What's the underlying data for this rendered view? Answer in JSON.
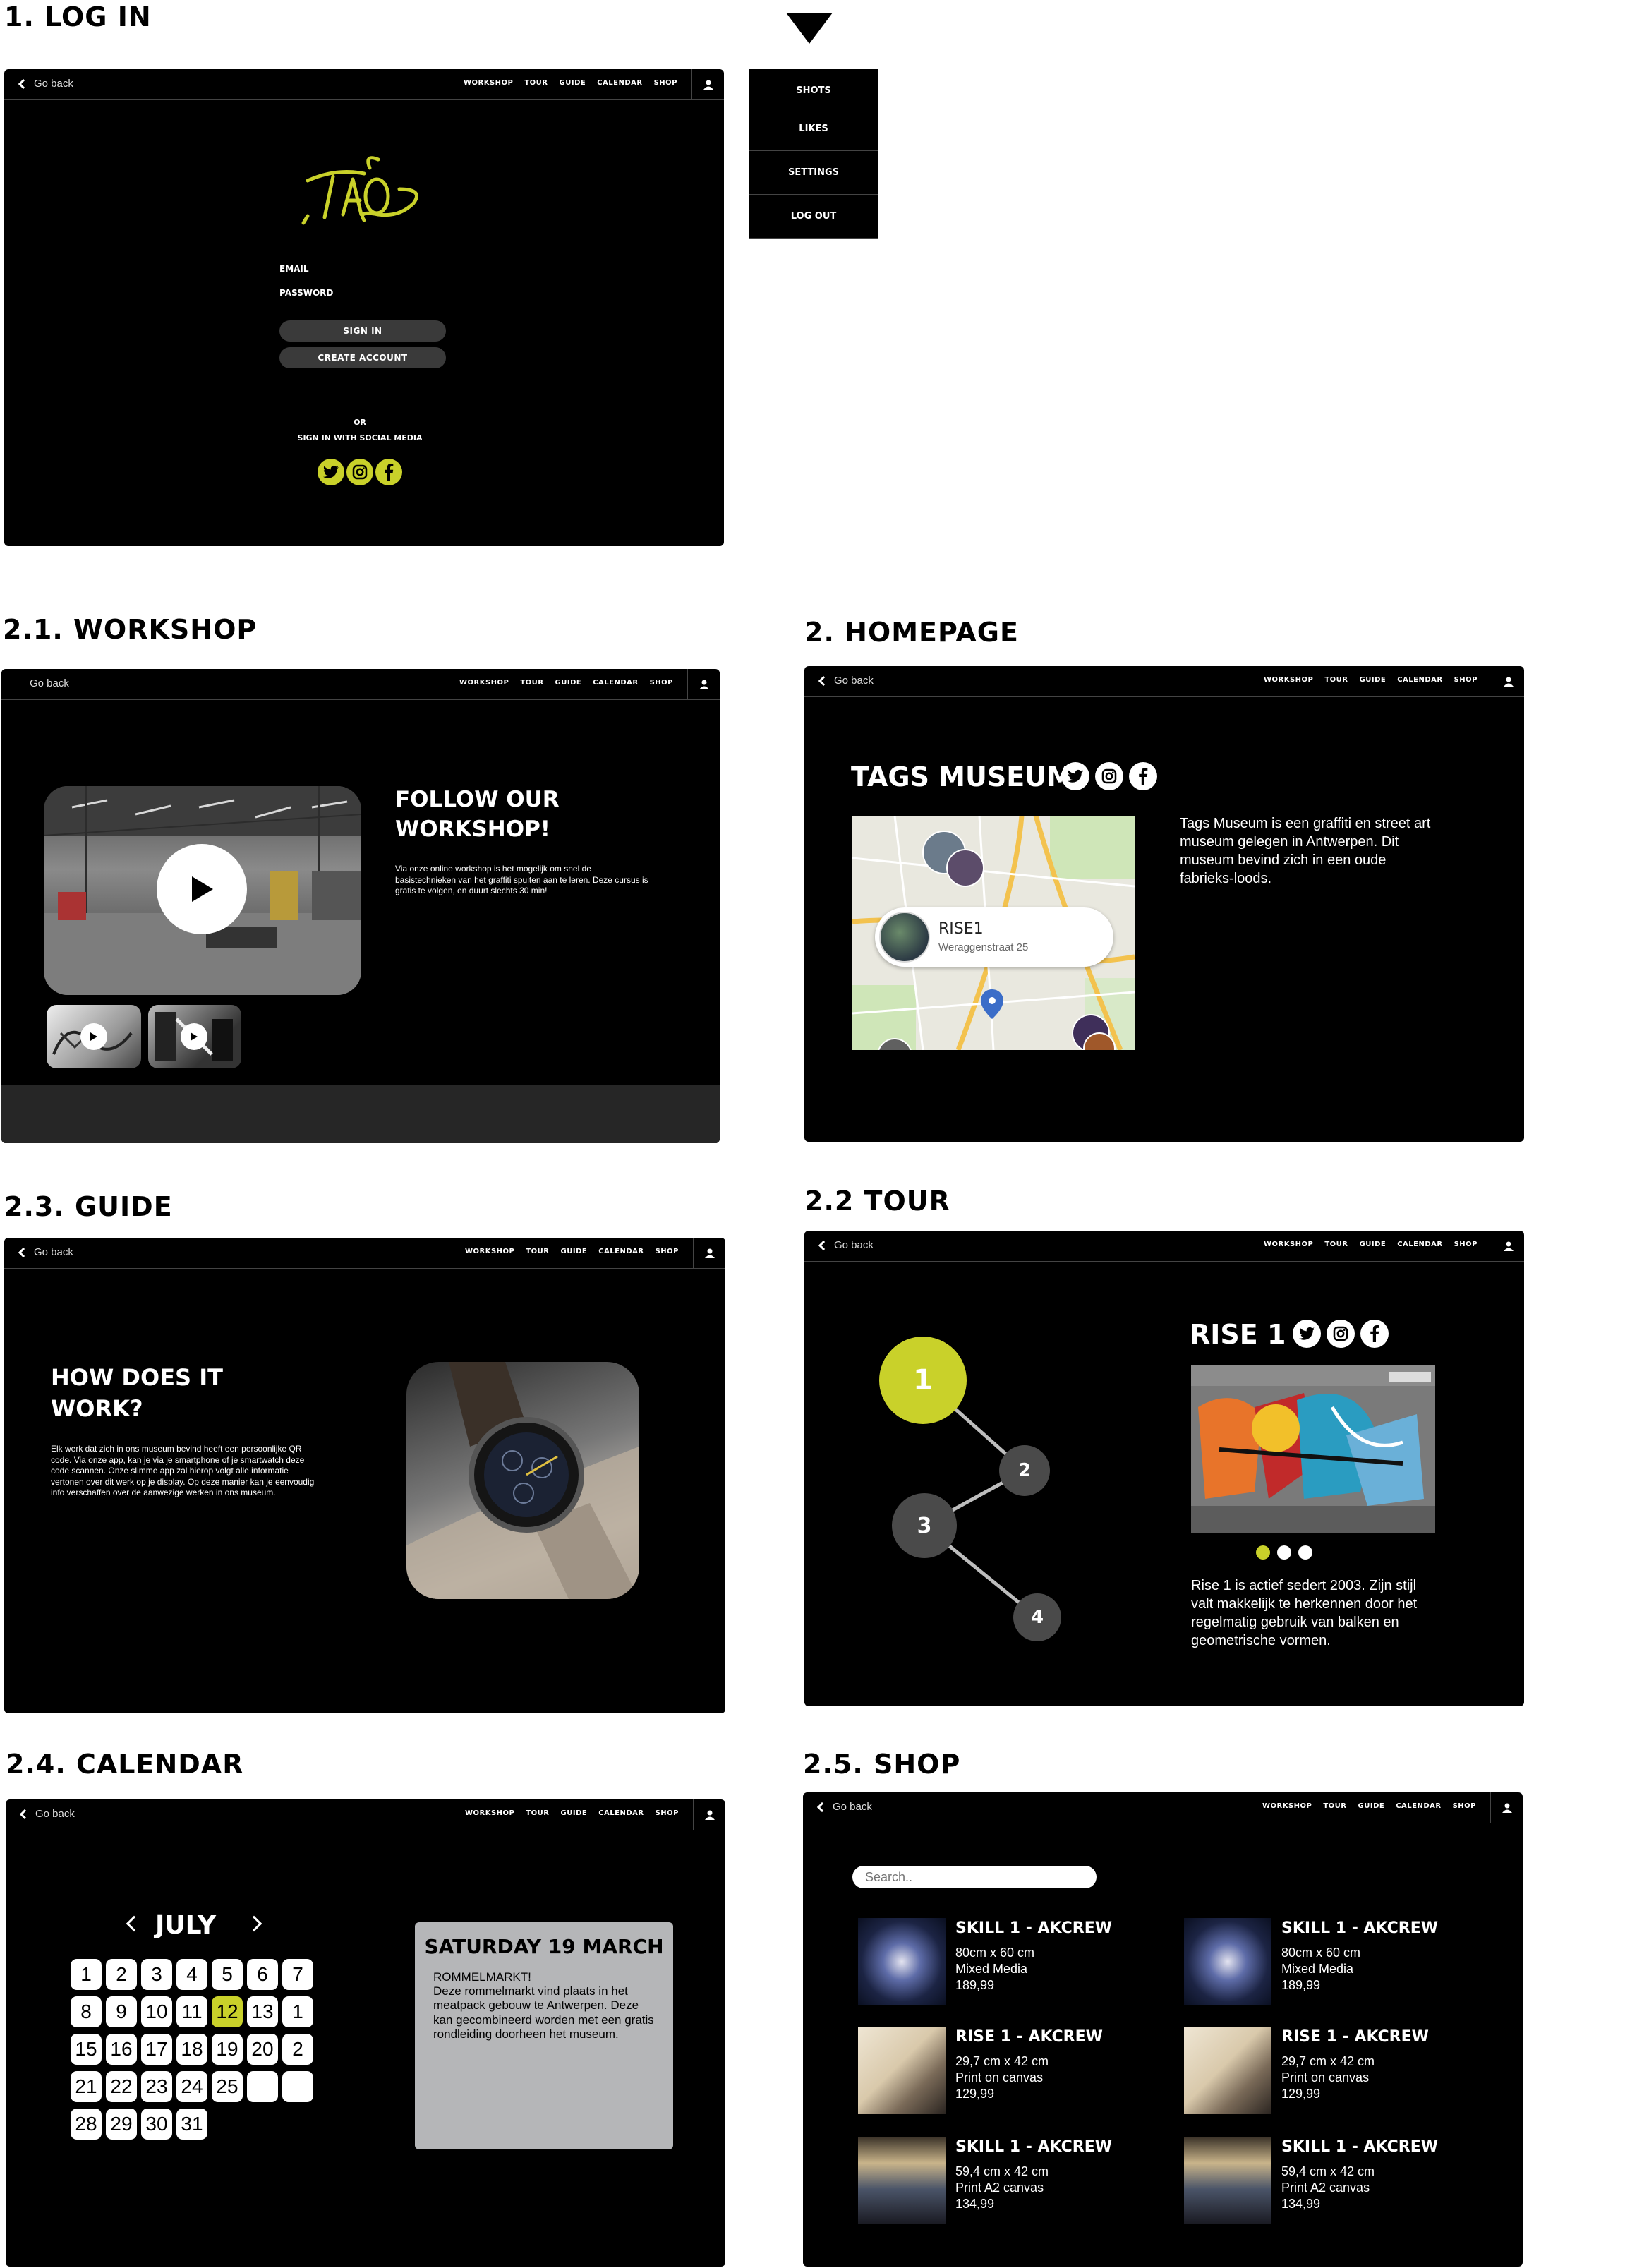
{
  "nav": {
    "back_label": "Go back",
    "links": [
      "WORKSHOP",
      "TOUR",
      "GUIDE",
      "CALENDAR",
      "SHOP"
    ]
  },
  "sections": {
    "login": "1. LOG IN",
    "workshop": "2.1. WORKSHOP",
    "homepage": "2. HOMEPAGE",
    "guide": "2.3. GUIDE",
    "tour": "2.2 TOUR",
    "calendar": "2.4. CALENDAR",
    "shop": "2.5. SHOP"
  },
  "user_menu": [
    "SHOTS",
    "LIKES",
    "SETTINGS",
    "LOG OUT"
  ],
  "login": {
    "email_label": "EMAIL",
    "password_label": "PASSWORD",
    "sign_in": "SIGN IN",
    "create_account": "CREATE ACCOUNT",
    "or": "OR",
    "social_text": "SIGN IN WITH SOCIAL MEDIA"
  },
  "workshop": {
    "title_line1": "FOLLOW OUR",
    "title_line2": "WORKSHOP!",
    "description": "Via onze online workshop is het mogelijk om snel de basistechnieken van het graffiti spuiten aan te leren. Deze cursus is gratis te volgen, en duurt slechts 30 min!"
  },
  "homepage": {
    "title": "TAGS MUSEUM",
    "description": "Tags Museum is een graffiti en street art museum gelegen in Antwerpen. Dit museum bevind zich in een oude fabrieks-loods.",
    "map_card_name": "RISE1",
    "map_card_address": "Weraggenstraat 25"
  },
  "guide": {
    "title_line1": "HOW DOES IT",
    "title_line2": "WORK?",
    "description": "Elk werk dat zich in ons museum bevind heeft een persoonlijke QR code. Via onze app, kan je via je smartphone of je smartwatch deze code scannen. Onze slimme app zal hierop volgt alle informatie vertonen over dit werk op je display. Op deze manier kan je eenvoudig info verschaffen over de aanwezige werken in ons museum."
  },
  "tour": {
    "nodes": [
      "1",
      "2",
      "3",
      "4"
    ],
    "artist": "RISE 1",
    "description": "Rise 1 is actief sedert 2003. Zijn stijl valt makkelijk te herkennen door het regelmatig gebruik van balken en geometrische  vormen.",
    "active_dot": 0,
    "dot_count": 3
  },
  "calendar": {
    "month": "JULY",
    "days": [
      "1",
      "2",
      "3",
      "4",
      "5",
      "6",
      "7",
      "8",
      "9",
      "10",
      "11",
      "12",
      "13",
      "1",
      "15",
      "16",
      "17",
      "18",
      "19",
      "20",
      "2",
      "21",
      "22",
      "23",
      "24",
      "25",
      "",
      "",
      "28",
      "29",
      "30",
      "31"
    ],
    "selected": "12",
    "event_title": "SATURDAY 19 MARCH",
    "event_name": "ROMMELMARKT!",
    "event_description": "Deze rommelmarkt vind plaats in het meatpack gebouw te Antwerpen. Deze kan gecombineerd worden met een gratis rondleiding doorheen het museum."
  },
  "shop": {
    "search_placeholder": "Search..",
    "products": [
      {
        "title": "SKILL 1 - AKCREW",
        "size": "80cm x 60 cm",
        "medium": "Mixed Media",
        "price": "189,99"
      },
      {
        "title": "SKILL 1 - AKCREW",
        "size": "80cm x 60 cm",
        "medium": "Mixed Media",
        "price": "189,99"
      },
      {
        "title": "RISE 1 - AKCREW",
        "size": "29,7 cm x 42 cm",
        "medium": "Print on canvas",
        "price": "129,99"
      },
      {
        "title": "RISE 1 - AKCREW",
        "size": "29,7 cm x 42 cm",
        "medium": "Print on canvas",
        "price": "129,99"
      },
      {
        "title": "SKILL 1 - AKCREW",
        "size": "59,4 cm x 42 cm",
        "medium": "Print A2 canvas",
        "price": "134,99"
      },
      {
        "title": "SKILL 1 - AKCREW",
        "size": "59,4 cm x 42 cm",
        "medium": "Print A2 canvas",
        "price": "134,99"
      }
    ]
  },
  "colors": {
    "accent": "#c9d12a",
    "bg": "#000000",
    "node_grey": "#4a4a4a"
  },
  "icons": [
    "chevron-left-icon",
    "user-icon",
    "twitter-icon",
    "instagram-icon",
    "facebook-icon",
    "play-icon",
    "map-pin-icon",
    "dropdown-triangle-icon"
  ]
}
